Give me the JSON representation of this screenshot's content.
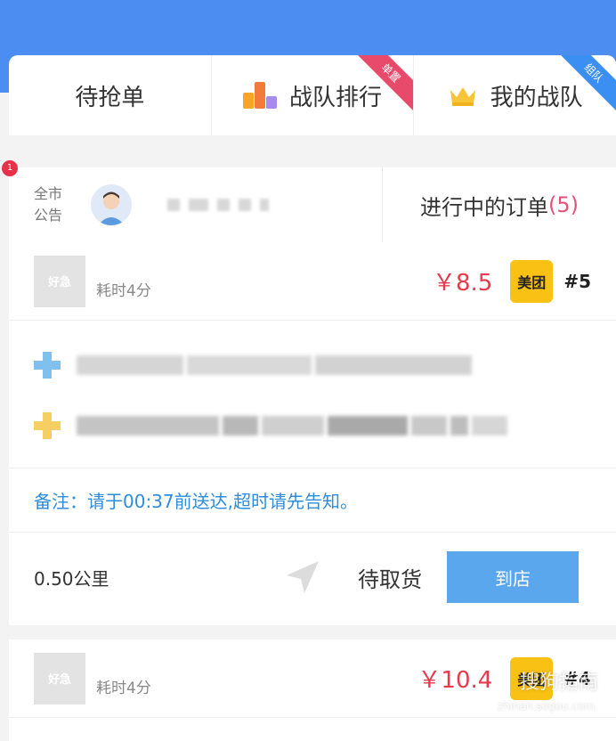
{
  "tabs": [
    {
      "label": "待抢单"
    },
    {
      "label": "战队排行",
      "ribbon": "单置"
    },
    {
      "label": "我的战队",
      "ribbon": "组队"
    }
  ],
  "announcement": {
    "city_label": "全市公告",
    "badge": "1",
    "orders_in_progress_label": "进行中的订单",
    "orders_in_progress_count": "(5)"
  },
  "orders": [
    {
      "logo_text": "好急",
      "elapsed": "耗时4分",
      "price": "￥8.5",
      "platform": "美团",
      "order_no": "#5",
      "note": "备注：请于00:37前送达,超时请先告知。",
      "distance": "0.50公里",
      "status": "待取货",
      "action": "到店"
    },
    {
      "logo_text": "好急",
      "elapsed": "耗时4分",
      "price": "￥10.4",
      "platform": "美团",
      "order_no": "#4"
    }
  ],
  "watermark": {
    "text": "搜狗指南",
    "sub": "zhinan.sogou.com"
  },
  "colors": {
    "header": "#4b8df1",
    "price": "#e83a4e",
    "note": "#2d8cdc",
    "button": "#5ba7ee",
    "platform": "#f9c114"
  }
}
